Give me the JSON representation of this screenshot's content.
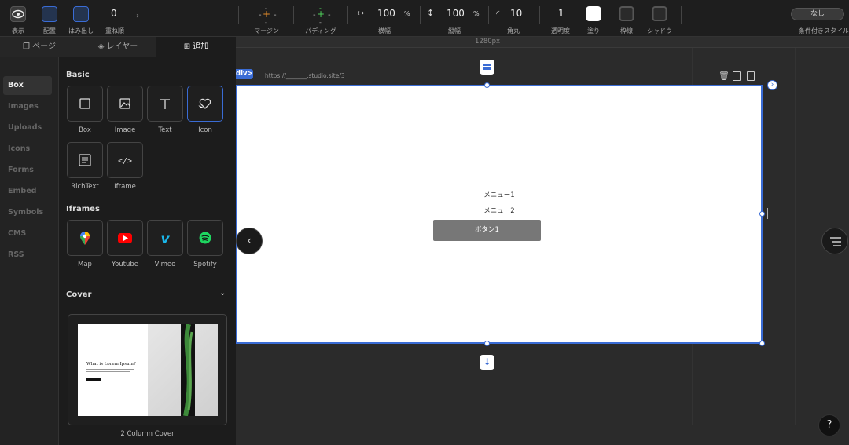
{
  "toolbar": {
    "display_label": "表示",
    "layout_label": "配置",
    "overflow_label": "はみ出し",
    "zorder_value": "0",
    "zorder_label": "重ね順",
    "margin_label": "マージン",
    "padding_label": "パディング",
    "width_value": "100",
    "width_unit": "%",
    "width_label": "横幅",
    "height_value": "100",
    "height_unit": "%",
    "height_label": "縦幅",
    "radius_value": "10",
    "radius_label": "角丸",
    "opacity_value": "1",
    "opacity_label": "透明度",
    "fill_label": "塗り",
    "border_label": "枠線",
    "shadow_label": "シャドウ",
    "conditional_value": "なし",
    "conditional_label": "条件付きスタイル"
  },
  "ruler": {
    "width_label": "1280px"
  },
  "tabs": {
    "pages": "ページ",
    "layers": "レイヤー",
    "add": "追加"
  },
  "leftnav": [
    "Box",
    "Images",
    "Uploads",
    "Icons",
    "Forms",
    "Embed",
    "Symbols",
    "CMS",
    "RSS"
  ],
  "panel": {
    "basic_title": "Basic",
    "basic_items": [
      "Box",
      "Image",
      "Text",
      "Icon",
      "RichText",
      "Iframe"
    ],
    "iframes_title": "Iframes",
    "iframe_items": [
      "Map",
      "Youtube",
      "Vimeo",
      "Spotify"
    ],
    "cover_title": "Cover",
    "cover_preview_heading": "What is Lorem Ipsum?",
    "cover_name": "2 Column Cover"
  },
  "canvas": {
    "element_tag": "div>",
    "url": "https://_______.studio.site/3",
    "menu1": "メニュー1",
    "menu2": "メニュー2",
    "button1": "ボタン1"
  },
  "help": {
    "label": "?"
  },
  "colors": {
    "accent": "#3a6cd5",
    "bg": "#1c1c1c",
    "button_bg": "#777777"
  }
}
